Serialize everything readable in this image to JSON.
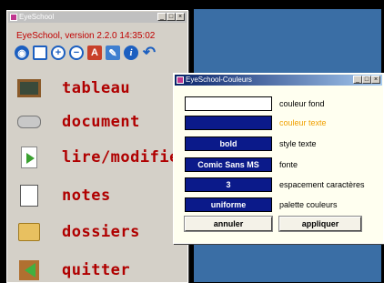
{
  "main_window": {
    "title": "EyeSchool",
    "version_line": "EyeSchool, version 2.2.0   14:35:02",
    "toolbar": [
      {
        "icon": "eye-icon",
        "glyph": "◉"
      },
      {
        "icon": "book-icon",
        "glyph": ""
      },
      {
        "icon": "zoom-in-icon",
        "glyph": "+"
      },
      {
        "icon": "zoom-out-icon",
        "glyph": "−"
      },
      {
        "icon": "font-icon",
        "glyph": "A"
      },
      {
        "icon": "pen-icon",
        "glyph": "✎"
      },
      {
        "icon": "info-icon",
        "glyph": "i"
      },
      {
        "icon": "undo-icon",
        "glyph": "↶"
      }
    ],
    "menu": [
      {
        "label": "tableau",
        "icon": "blackboard-icon"
      },
      {
        "label": "document",
        "icon": "scanner-icon"
      },
      {
        "label": "lire/modifier",
        "icon": "edit-document-icon"
      },
      {
        "label": "notes",
        "icon": "notes-icon"
      },
      {
        "label": "dossiers",
        "icon": "folder-icon"
      },
      {
        "label": "quitter",
        "icon": "exit-door-icon"
      }
    ]
  },
  "color_window": {
    "title": "EyeSchool-Couleurs",
    "rows": [
      {
        "value": "",
        "label": "couleur fond"
      },
      {
        "value": "",
        "label": "couleur texte"
      },
      {
        "value": "bold",
        "label": "style texte"
      },
      {
        "value": "Comic Sans MS",
        "label": "fonte"
      },
      {
        "value": "3",
        "label": "espacement caractères"
      },
      {
        "value": "uniforme",
        "label": "palette couleurs"
      }
    ],
    "cancel_label": "annuler",
    "apply_label": "appliquer"
  },
  "colors": {
    "accent_red": "#b00000",
    "navy_button": "#0b1a8a",
    "desktop_blue": "#3a6ea5",
    "dialog_bg": "#fffff0",
    "text_color_label": "#f0a000"
  }
}
